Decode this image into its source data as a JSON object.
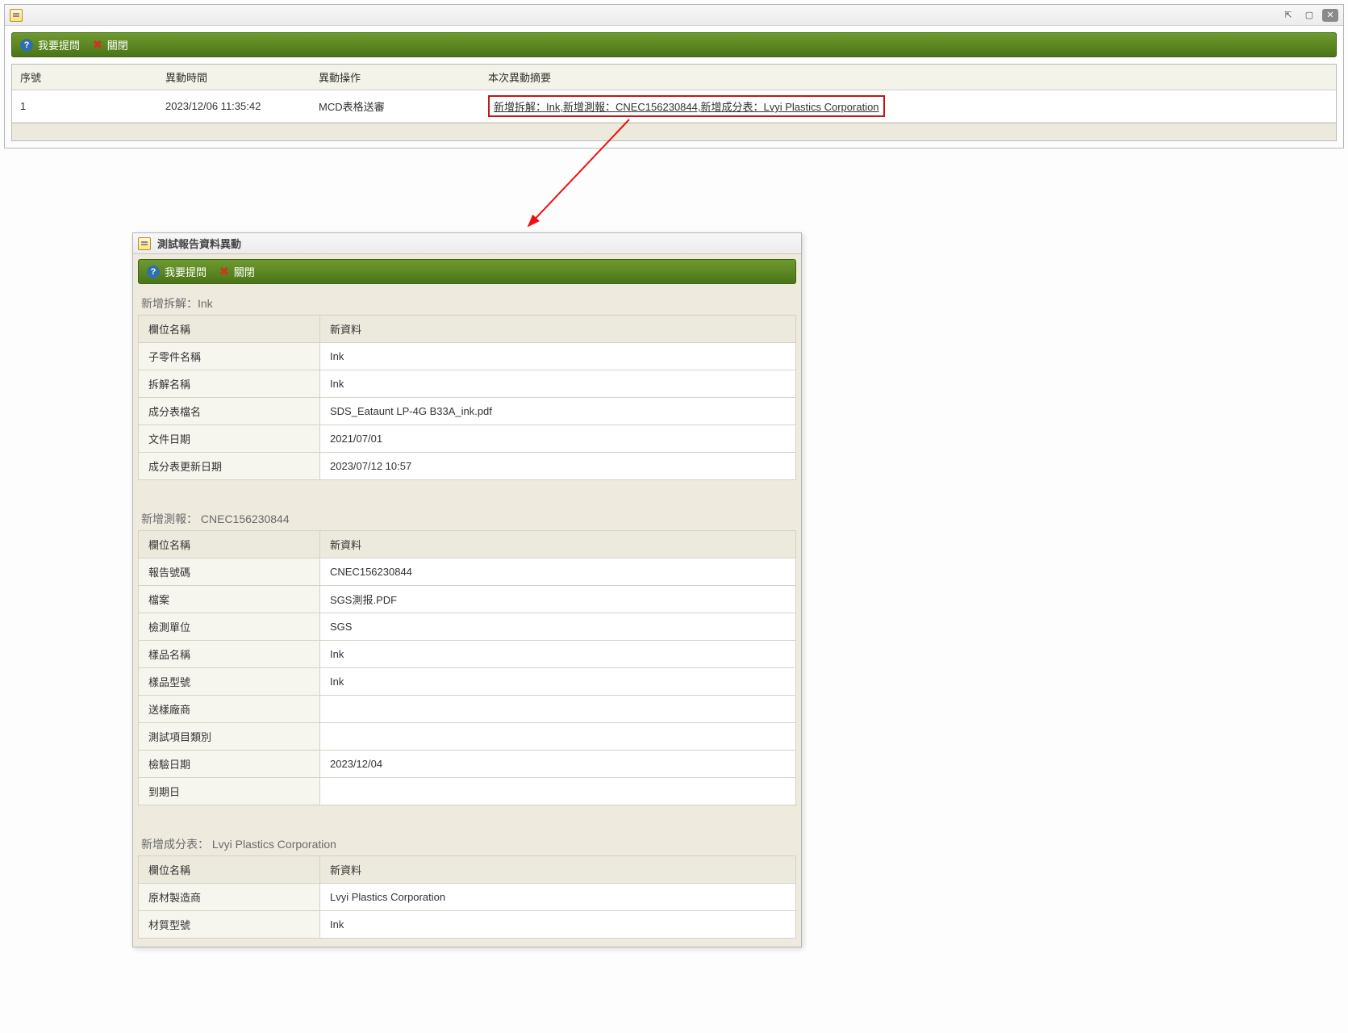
{
  "main": {
    "toolbar": {
      "ask_label": "我要提問",
      "close_label": "關閉"
    },
    "columns": {
      "seq": "序號",
      "time": "異動時間",
      "op": "異動操作",
      "summary": "本次異動摘要"
    },
    "rows": [
      {
        "seq": "1",
        "time": "2023/12/06 11:35:42",
        "op": "MCD表格送審",
        "summary": "新增拆解：Ink,新增測報：CNEC156230844,新增成分表：Lvyi Plastics Corporation"
      }
    ]
  },
  "detail": {
    "title": "測試報告資料異動",
    "toolbar": {
      "ask_label": "我要提問",
      "close_label": "關閉"
    },
    "sections": [
      {
        "heading": "新增拆解：Ink",
        "header": {
          "k": "欄位名稱",
          "v": "新資料"
        },
        "rows": [
          {
            "k": "子零件名稱",
            "v": "Ink"
          },
          {
            "k": "拆解名稱",
            "v": "Ink"
          },
          {
            "k": "成分表檔名",
            "v": "SDS_Eataunt LP-4G B33A_ink.pdf"
          },
          {
            "k": "文件日期",
            "v": "2021/07/01"
          },
          {
            "k": "成分表更新日期",
            "v": "2023/07/12 10:57"
          }
        ]
      },
      {
        "heading": "新增測報： CNEC156230844",
        "header": {
          "k": "欄位名稱",
          "v": "新資料"
        },
        "rows": [
          {
            "k": "報告號碼",
            "v": "CNEC156230844"
          },
          {
            "k": "檔案",
            "v": "SGS測报.PDF"
          },
          {
            "k": "檢測單位",
            "v": "SGS"
          },
          {
            "k": "樣品名稱",
            "v": "Ink"
          },
          {
            "k": "樣品型號",
            "v": "Ink"
          },
          {
            "k": "送樣廠商",
            "v": ""
          },
          {
            "k": "測試項目類別",
            "v": ""
          },
          {
            "k": "檢驗日期",
            "v": "2023/12/04"
          },
          {
            "k": "到期日",
            "v": ""
          }
        ]
      },
      {
        "heading": "新增成分表： Lvyi Plastics Corporation",
        "header": {
          "k": "欄位名稱",
          "v": "新資料"
        },
        "rows": [
          {
            "k": "原材製造商",
            "v": "Lvyi Plastics Corporation"
          },
          {
            "k": "材質型號",
            "v": "Ink"
          }
        ]
      }
    ]
  }
}
